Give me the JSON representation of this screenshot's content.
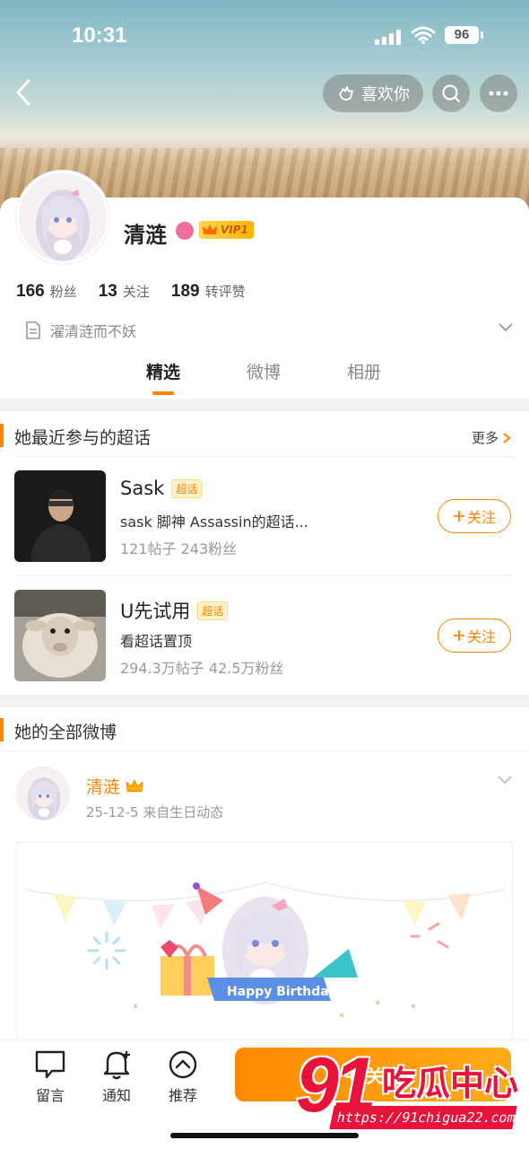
{
  "status_bar": {
    "time": "10:31",
    "battery": "96"
  },
  "header": {
    "like_label": "喜欢你"
  },
  "profile": {
    "name": "清涟",
    "vip_label": "VIP1",
    "stats": [
      {
        "value": "166",
        "label": "粉丝"
      },
      {
        "value": "13",
        "label": "关注"
      },
      {
        "value": "189",
        "label": "转评赞"
      }
    ],
    "bio": "濯清涟而不妖"
  },
  "tabs": [
    {
      "label": "精选",
      "active": true
    },
    {
      "label": "微博",
      "active": false
    },
    {
      "label": "相册",
      "active": false
    }
  ],
  "supertopics": {
    "title": "她最近参与的超话",
    "more_label": "更多",
    "items": [
      {
        "name": "Sask",
        "tag": "超话",
        "desc": "sask 脚神 Assassin的超话...",
        "meta": "121帖子 243粉丝",
        "follow_label": "关注"
      },
      {
        "name": "U先试用",
        "tag": "超话",
        "desc": "看超话置顶",
        "meta": "294.3万帖子 42.5万粉丝",
        "follow_label": "关注"
      }
    ]
  },
  "posts_section": {
    "title": "她的全部微博"
  },
  "post": {
    "author": "清涟",
    "meta": "25-12-5  来自生日动态",
    "image_caption": "Happy Birthday"
  },
  "bottom_bar": {
    "items": [
      {
        "label": "留言",
        "icon": "message-icon"
      },
      {
        "label": "通知",
        "icon": "bell-plus-icon"
      },
      {
        "label": "推荐",
        "icon": "chevron-up-circle-icon"
      }
    ],
    "follow_label": "+ 关注"
  },
  "watermark": {
    "number": "91",
    "text": "吃瓜中心",
    "url": "https://91chigua22.com"
  },
  "colors": {
    "accent": "#ff8200",
    "watermark": "#e8133a"
  }
}
